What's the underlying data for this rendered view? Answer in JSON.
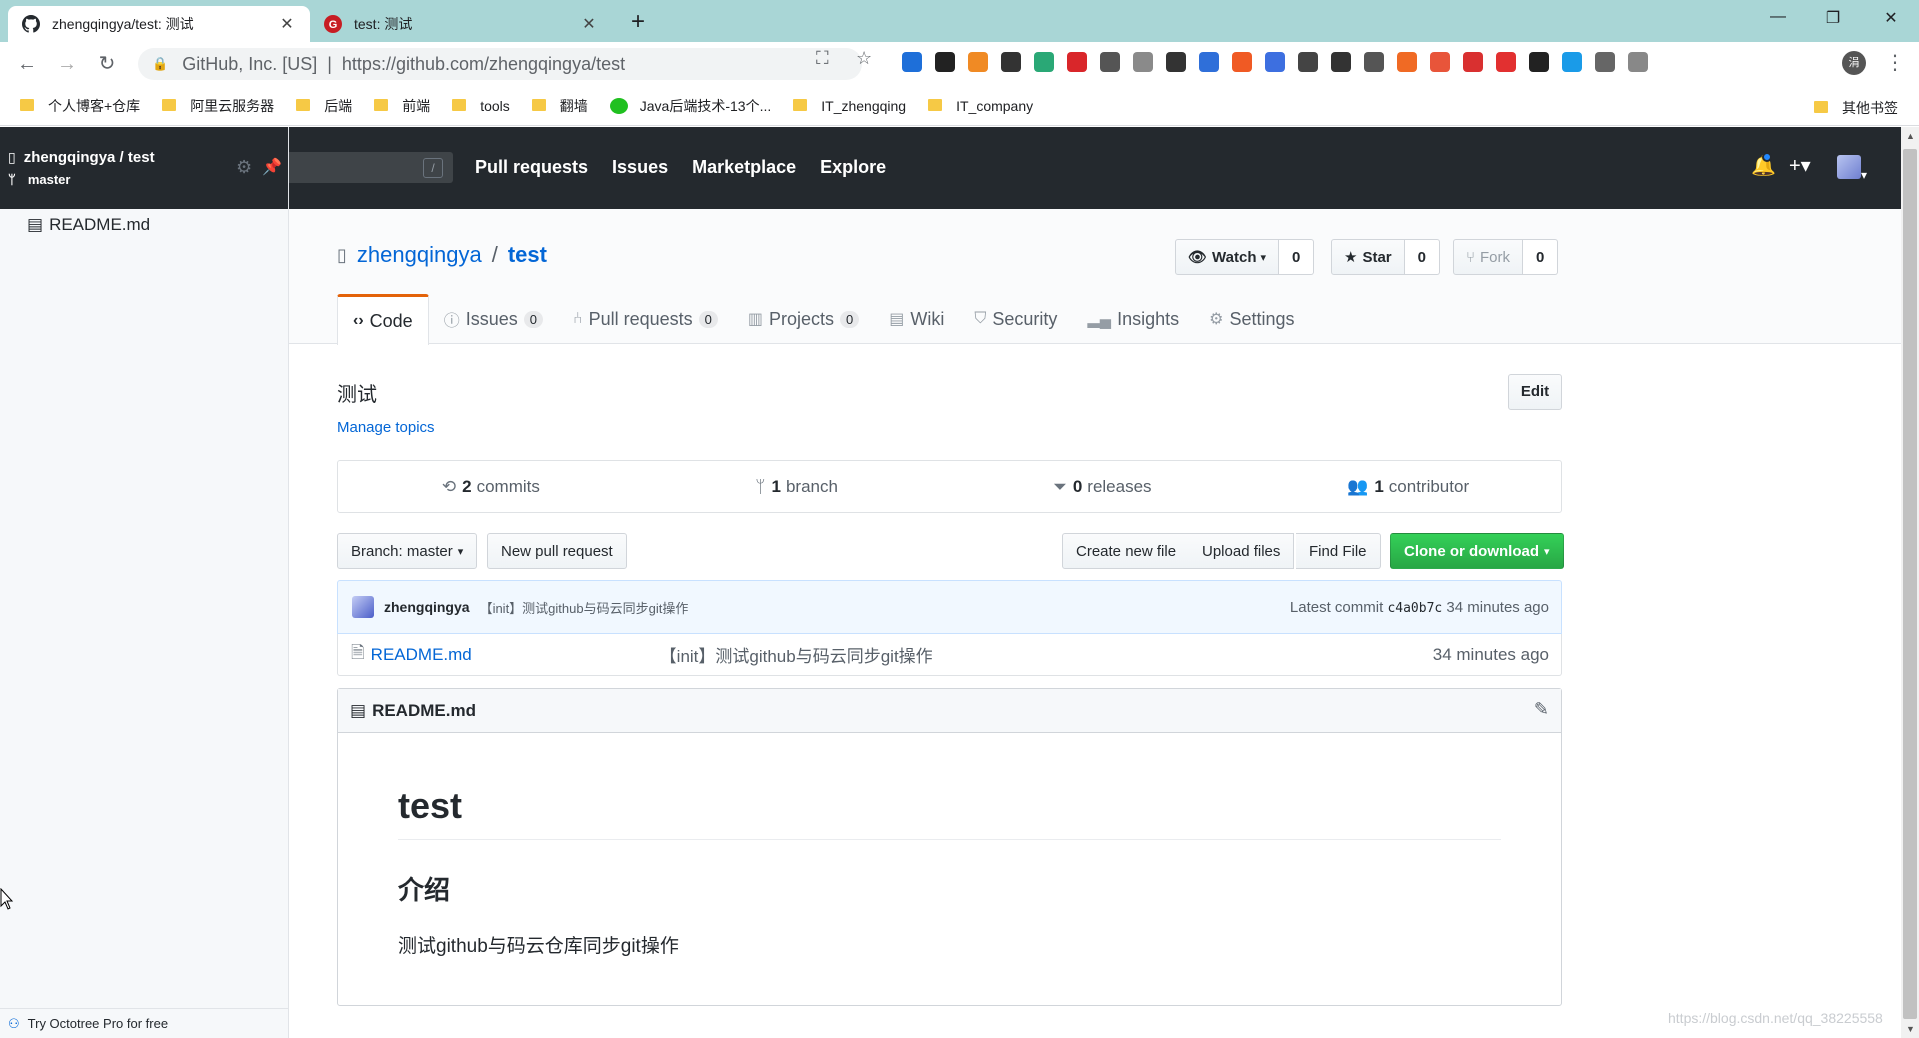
{
  "browser": {
    "tabs": [
      {
        "title": "zhengqingya/test: 测试",
        "icon": "github-icon",
        "active": true
      },
      {
        "title": "test: 测试",
        "icon": "gitee-icon",
        "active": false
      }
    ],
    "omnibox": {
      "site": "GitHub, Inc. [US]",
      "separator": "|",
      "url": "https://github.com/zhengqingya/test"
    },
    "profile_initial": "涓",
    "bookmarks": [
      {
        "label": "个人博客+仓库",
        "type": "folder"
      },
      {
        "label": "阿里云服务器",
        "type": "folder"
      },
      {
        "label": "后端",
        "type": "folder"
      },
      {
        "label": "前端",
        "type": "folder"
      },
      {
        "label": "tools",
        "type": "folder"
      },
      {
        "label": "翻墙",
        "type": "folder"
      },
      {
        "label": "Java后端技术-13个...",
        "type": "wechat"
      },
      {
        "label": "IT_zhengqing",
        "type": "folder"
      },
      {
        "label": "IT_company",
        "type": "folder"
      }
    ],
    "other_bookmarks": "其他书签",
    "extension_colors": [
      "#1e6fd9",
      "#222222",
      "#f08a24",
      "#333333",
      "#2aa876",
      "#d9262a",
      "#555555",
      "#8a8a8a",
      "#333333",
      "#2f6fd9",
      "#f05a24",
      "#3d6fe0",
      "#444444",
      "#333333",
      "#555555",
      "#f06a24",
      "#e8553a",
      "#d93030",
      "#e23030",
      "#222222",
      "#1a9be8",
      "#666666",
      "#888888"
    ]
  },
  "octotree": {
    "repo": "zhengqingya / test",
    "branch": "master",
    "files": [
      "README.md"
    ],
    "footer": "Try Octotree Pro for free"
  },
  "header": {
    "search_shortcut": "/",
    "nav": [
      "Pull requests",
      "Issues",
      "Marketplace",
      "Explore"
    ]
  },
  "repo": {
    "owner": "zhengqingya",
    "separator": "/",
    "name": "test",
    "watch": {
      "label": "Watch",
      "count": "0"
    },
    "star": {
      "label": "Star",
      "count": "0"
    },
    "fork": {
      "label": "Fork",
      "count": "0"
    },
    "tabs": [
      {
        "label": "Code",
        "icon": "code-icon",
        "counter": null,
        "selected": true
      },
      {
        "label": "Issues",
        "icon": "issue-icon",
        "counter": "0"
      },
      {
        "label": "Pull requests",
        "icon": "pull-request-icon",
        "counter": "0"
      },
      {
        "label": "Projects",
        "icon": "project-icon",
        "counter": "0"
      },
      {
        "label": "Wiki",
        "icon": "book-icon",
        "counter": null
      },
      {
        "label": "Security",
        "icon": "shield-icon",
        "counter": null
      },
      {
        "label": "Insights",
        "icon": "graph-icon",
        "counter": null
      },
      {
        "label": "Settings",
        "icon": "gear-icon",
        "counter": null
      }
    ]
  },
  "main": {
    "description": "测试",
    "manage_topics": "Manage topics",
    "edit": "Edit",
    "summary": {
      "commits_num": "2",
      "commits_label": "commits",
      "branch_num": "1",
      "branch_label": "branch",
      "releases_num": "0",
      "releases_label": "releases",
      "contributor_num": "1",
      "contributor_label": "contributor"
    },
    "branch_select": "Branch: master",
    "new_pull_request": "New pull request",
    "create_new_file": "Create new file",
    "upload_files": "Upload files",
    "find_file": "Find File",
    "clone_or_download": "Clone or download",
    "commit": {
      "author": "zhengqingya",
      "message": "【init】测试github与码云同步git操作",
      "latest_label": "Latest commit",
      "sha": "c4a0b7c",
      "age": "34 minutes ago"
    },
    "files": [
      {
        "name": "README.md",
        "message": "【init】测试github与码云同步git操作",
        "age": "34 minutes ago"
      }
    ],
    "readme": {
      "filename": "README.md",
      "h1": "test",
      "h2": "介绍",
      "p": "测试github与码云仓库同步git操作"
    }
  },
  "watermark": "https://blog.csdn.net/qq_38225558",
  "colors": {
    "accent": "#0366d6",
    "header": "#24292e",
    "selected_tab": "#e36209",
    "green": "#28a745",
    "tabstrip": "#a9d6d6"
  }
}
